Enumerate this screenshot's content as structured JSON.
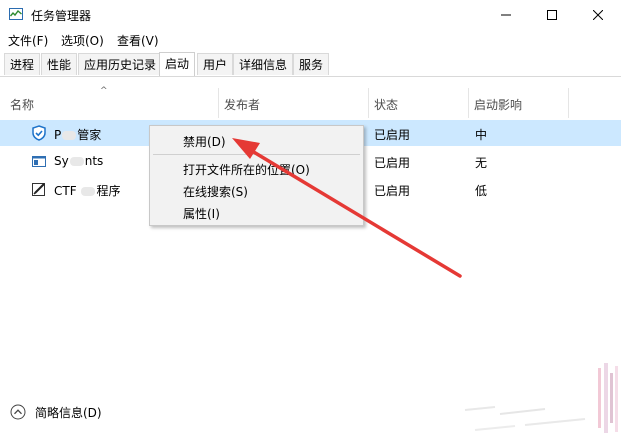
{
  "window": {
    "title": "任务管理器",
    "accent_arrow_color": "#e53935",
    "selected_row_color": "#cce8ff"
  },
  "menubar": {
    "items": [
      "文件(F)",
      "选项(O)",
      "查看(V)"
    ]
  },
  "tabs": [
    {
      "label": "进程",
      "active": false
    },
    {
      "label": "性能",
      "active": false
    },
    {
      "label": "应用历史记录",
      "active": false
    },
    {
      "label": "启动",
      "active": true
    },
    {
      "label": "用户",
      "active": false
    },
    {
      "label": "详细信息",
      "active": false
    },
    {
      "label": "服务",
      "active": false
    }
  ],
  "table": {
    "columns": [
      "名称",
      "发布者",
      "状态",
      "启动影响"
    ],
    "rows": [
      {
        "name_prefix": "P",
        "name_suffix": "管家",
        "icon": "shield-icon",
        "publisher": "",
        "status": "已启用",
        "impact": "中",
        "selected": true
      },
      {
        "name_prefix": "Sy",
        "name_suffix": "nts",
        "icon": "window-icon",
        "publisher": "",
        "status": "已启用",
        "impact": "无",
        "selected": false
      },
      {
        "name_prefix": "CTF ",
        "name_suffix": "程序",
        "icon": "pen-icon",
        "publisher": "",
        "status": "已启用",
        "impact": "低",
        "selected": false
      }
    ]
  },
  "context_menu": {
    "items": [
      "禁用(D)",
      "打开文件所在的位置(O)",
      "在线搜索(S)",
      "属性(I)"
    ]
  },
  "footer": {
    "fewer_details": "简略信息(D)"
  }
}
